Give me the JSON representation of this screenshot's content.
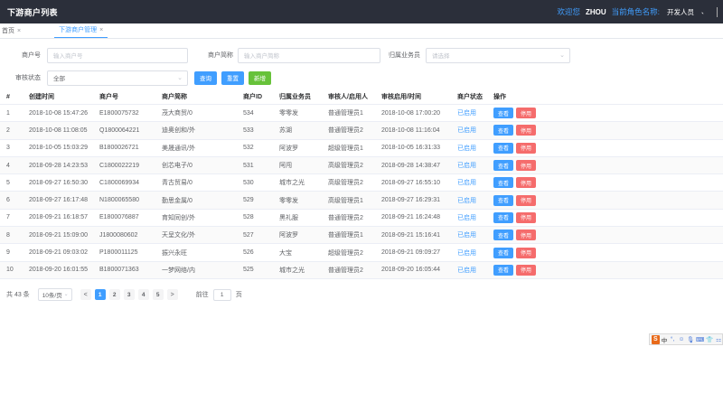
{
  "topbar": {
    "title": "下游商户列表",
    "welcome": "欢迎您",
    "user": "ZHOU",
    "role_label": "当前角色名称:",
    "role": "开发人员",
    "caret": "、"
  },
  "tabs": [
    {
      "label": "首页",
      "close": "×"
    },
    {
      "label": "下游商户管理",
      "close": "×"
    }
  ],
  "filter": {
    "merchant_no_label": "商户号",
    "merchant_no_placeholder": "输入商户号",
    "merchant_short_label": "商户简称",
    "merchant_short_placeholder": "输入商户简称",
    "salesman_label": "归属业务员",
    "salesman_placeholder": "请选择",
    "audit_label": "审核状态",
    "audit_value": "全部",
    "query_btn": "查询",
    "reset_btn": "重置",
    "add_btn": "新增"
  },
  "table": {
    "headers": [
      "#",
      "创建时间",
      "商户号",
      "商户简称",
      "商户ID",
      "归属业务员",
      "审核人/启用人",
      "审核启用/时间",
      "商户状态",
      "操作"
    ],
    "view_label": "查看",
    "stop_label": "停用",
    "rows": [
      [
        "1",
        "2018-10-08 15:47:26",
        "E1800075732",
        "茂大商贸/0",
        "534",
        "零零发",
        "普通管理员1",
        "2018-10-08 17:00:20",
        "已启用"
      ],
      [
        "2",
        "2018-10-08 11:08:05",
        "Q1800064221",
        "迪奥创和/外",
        "533",
        "苏湖",
        "普通管理员2",
        "2018-10-08 11:16:04",
        "已启用"
      ],
      [
        "3",
        "2018-10-05 15:03:29",
        "B1800026721",
        "美晟通讯/外",
        "532",
        "阿波罗",
        "超级管理员1",
        "2018-10-05 16:31:33",
        "已启用"
      ],
      [
        "4",
        "2018-09-28 14:23:53",
        "C1800022219",
        "创芯电子/0",
        "531",
        "阿闯",
        "高级管理员2",
        "2018-09-28 14:38:47",
        "已启用"
      ],
      [
        "5",
        "2018-09-27 16:50:30",
        "C1800069934",
        "青古贸易/0",
        "530",
        "城市之光",
        "高级管理员2",
        "2018-09-27 16:55:10",
        "已启用"
      ],
      [
        "6",
        "2018-09-27 16:17:48",
        "N1800065580",
        "勤思金属/0",
        "529",
        "零零发",
        "高级管理员1",
        "2018-09-27 16:29:31",
        "已启用"
      ],
      [
        "7",
        "2018-09-21 16:18:57",
        "E1800076887",
        "育知同创/外",
        "528",
        "黑礼服",
        "普通管理员2",
        "2018-09-21 16:24:48",
        "已启用"
      ],
      [
        "8",
        "2018-09-21 15:09:00",
        "J1800080602",
        "天呈文化/外",
        "527",
        "阿波罗",
        "普通管理员1",
        "2018-09-21 15:16:41",
        "已启用"
      ],
      [
        "9",
        "2018-09-21 09:03:02",
        "P1800011125",
        "振兴永旺",
        "526",
        "大宝",
        "超级管理员2",
        "2018-09-21 09:09:27",
        "已启用"
      ],
      [
        "10",
        "2018-09-20 16:01:55",
        "B1800071363",
        "一梦网络/内",
        "525",
        "城市之光",
        "普通管理员2",
        "2018-09-20 16:05:44",
        "已启用"
      ]
    ]
  },
  "pager": {
    "total": "共 43 条",
    "page_size": "10条/页",
    "prev": "<",
    "next": ">",
    "pages": [
      "1",
      "2",
      "3",
      "4",
      "5"
    ],
    "goto_label": "前往",
    "goto_value": "1",
    "page_unit": "页"
  },
  "ime": {
    "logo": "S",
    "mode": "中",
    "punct": "°,",
    "emoji": "☺",
    "voice": "🎙",
    "keyboard": "⌨",
    "skin": "👕",
    "tools": "⚏"
  }
}
